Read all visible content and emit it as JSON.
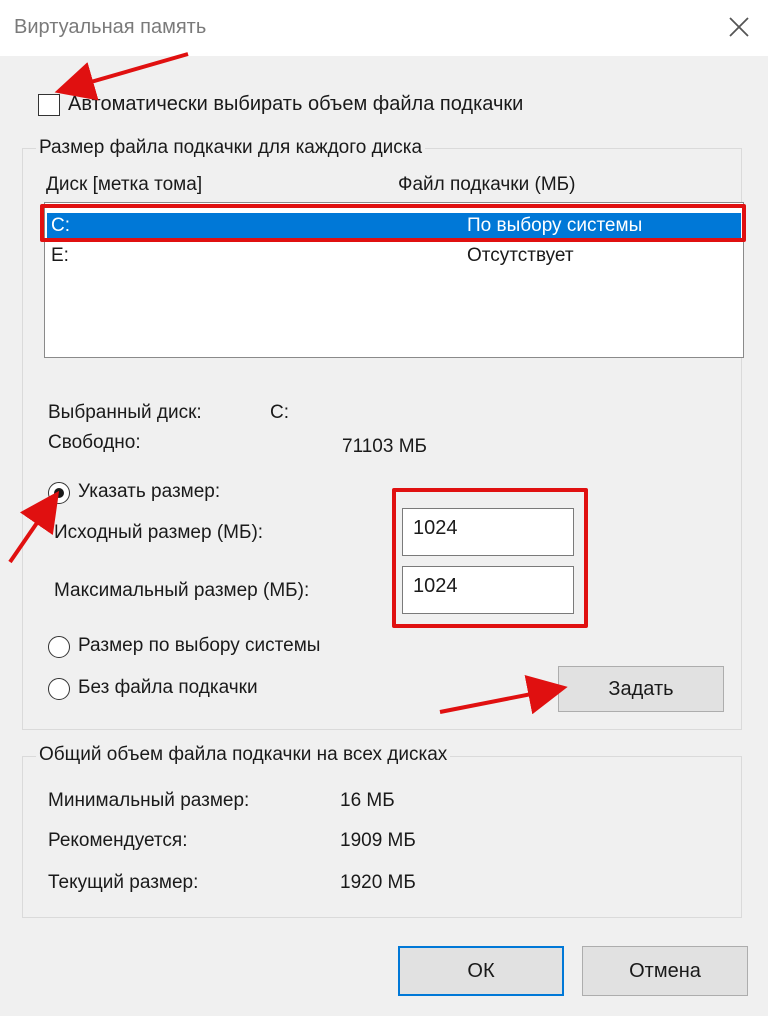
{
  "window": {
    "title": "Виртуальная память"
  },
  "auto_checkbox": {
    "label": "Автоматически выбирать объем файла подкачки",
    "checked": false
  },
  "per_disk_group": {
    "title": "Размер файла подкачки для каждого диска",
    "columns": [
      "Диск [метка тома]",
      "Файл подкачки (МБ)"
    ],
    "rows": [
      {
        "disk": "C:",
        "paging": "По выбору системы",
        "selected": true
      },
      {
        "disk": "E:",
        "paging": "Отсутствует",
        "selected": false
      }
    ],
    "selected_disk_label": "Выбранный диск:",
    "selected_disk_value": "C:",
    "free_label": "Свободно:",
    "free_value": "71103 МБ",
    "custom_size_radio": {
      "label": "Указать размер:",
      "checked": true
    },
    "initial_size": {
      "label": "Исходный размер (МБ):",
      "value": "1024"
    },
    "max_size": {
      "label": "Максимальный размер (МБ):",
      "value": "1024"
    },
    "system_size_radio": {
      "label": "Размер по выбору системы",
      "checked": false
    },
    "no_file_radio": {
      "label": "Без файла подкачки",
      "checked": false
    },
    "set_button": "Задать"
  },
  "total_group": {
    "title": "Общий объем файла подкачки на всех дисках",
    "min_label": "Минимальный размер:",
    "min_value": "16 МБ",
    "recommended_label": "Рекомендуется:",
    "recommended_value": "1909 МБ",
    "current_label": "Текущий размер:",
    "current_value": "1920 МБ"
  },
  "footer": {
    "ok": "ОК",
    "cancel": "Отмена"
  },
  "icons": {
    "close": "close-icon",
    "arrow": "red-arrow-annotation"
  },
  "colors": {
    "selection": "#0078d7",
    "annotation": "#e01010"
  }
}
